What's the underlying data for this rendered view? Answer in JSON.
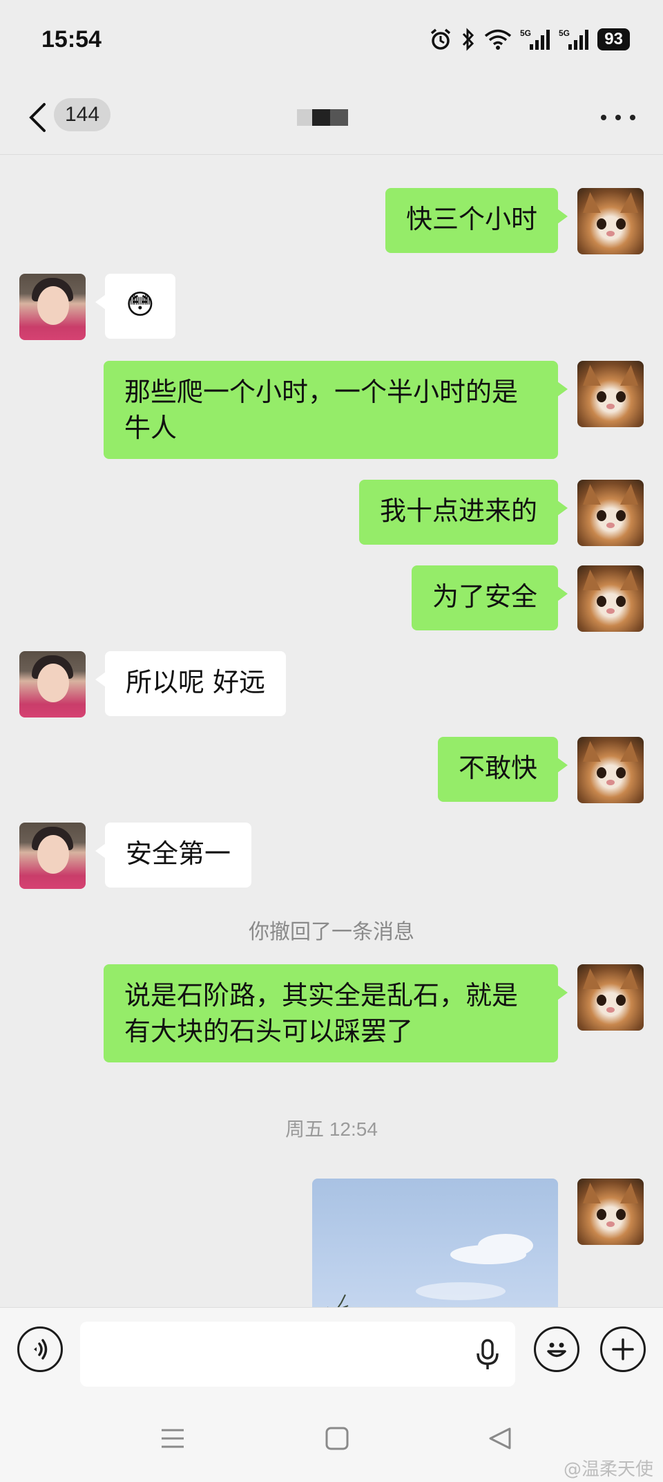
{
  "status_bar": {
    "time": "15:54",
    "battery": "93",
    "signal_labels": [
      "5G",
      "5G"
    ]
  },
  "header": {
    "unread_count": "144",
    "title_redacted": true
  },
  "messages": [
    {
      "from": "me",
      "text": "快三个小时"
    },
    {
      "from": "them",
      "text": "😳"
    },
    {
      "from": "me",
      "text": "那些爬一个小时，一个半小时的是牛人"
    },
    {
      "from": "me",
      "text": "我十点进来的"
    },
    {
      "from": "me",
      "text": "为了安全"
    },
    {
      "from": "them",
      "text": "所以呢 好远"
    },
    {
      "from": "me",
      "text": "不敢快"
    },
    {
      "from": "them",
      "text": "安全第一"
    },
    {
      "from": "system",
      "text": "你撤回了一条消息"
    },
    {
      "from": "me",
      "text": "说是石阶路，其实全是乱石，就是有大块的石头可以踩罢了"
    },
    {
      "from": "timestamp",
      "text": "周五 12:54"
    },
    {
      "from": "me",
      "type": "image"
    }
  ],
  "input_bar": {
    "placeholder": ""
  },
  "watermark": "@温柔天使",
  "colors": {
    "my_bubble": "#95ec69",
    "their_bubble": "#ffffff",
    "chat_background": "#ededed"
  },
  "icons": {
    "back": "chevron-left-icon",
    "more": "more-dots-icon",
    "voice": "voice-icon",
    "mic": "microphone-icon",
    "emoji": "emoji-icon",
    "add": "plus-icon"
  }
}
